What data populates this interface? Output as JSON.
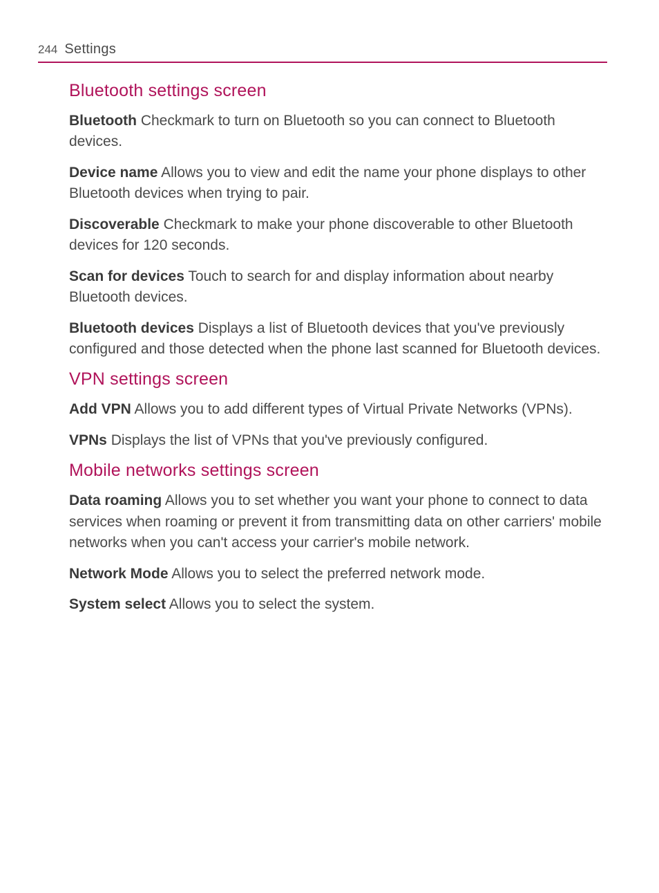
{
  "header": {
    "pageNumber": "244",
    "title": "Settings"
  },
  "sections": {
    "bluetooth": {
      "heading": "Bluetooth settings screen",
      "items": {
        "bluetooth": {
          "term": "Bluetooth",
          "desc": " Checkmark to turn on Bluetooth so you can connect to Bluetooth devices."
        },
        "deviceName": {
          "term": "Device name",
          "desc": " Allows you to view and edit the name your phone displays to other Bluetooth devices when trying to pair."
        },
        "discoverable": {
          "term": "Discoverable",
          "desc": " Checkmark to make your phone discoverable to other Bluetooth devices for 120 seconds."
        },
        "scan": {
          "term": "Scan for devices",
          "desc": " Touch to search for and display information about nearby Bluetooth devices."
        },
        "btDevices": {
          "term": "Bluetooth devices",
          "desc": " Displays a list of Bluetooth devices that you've previously configured and those detected when the phone last scanned for Bluetooth devices."
        }
      }
    },
    "vpn": {
      "heading": "VPN settings screen",
      "items": {
        "addVpn": {
          "term": "Add VPN",
          "desc": " Allows you to add different types of Virtual Private Networks (VPNs)."
        },
        "vpns": {
          "term": "VPNs",
          "desc": " Displays the list of VPNs that you've previously configured."
        }
      }
    },
    "mobile": {
      "heading": "Mobile networks settings screen",
      "items": {
        "dataRoaming": {
          "term": "Data roaming",
          "desc": " Allows you to set whether you want your phone to connect to data services when roaming or prevent it from transmitting data on other carriers' mobile networks when you can't access your carrier's mobile network."
        },
        "networkMode": {
          "term": "Network Mode",
          "desc": " Allows you to select the preferred network mode."
        },
        "systemSelect": {
          "term": "System select",
          "desc": " Allows you to select the system."
        }
      }
    }
  }
}
